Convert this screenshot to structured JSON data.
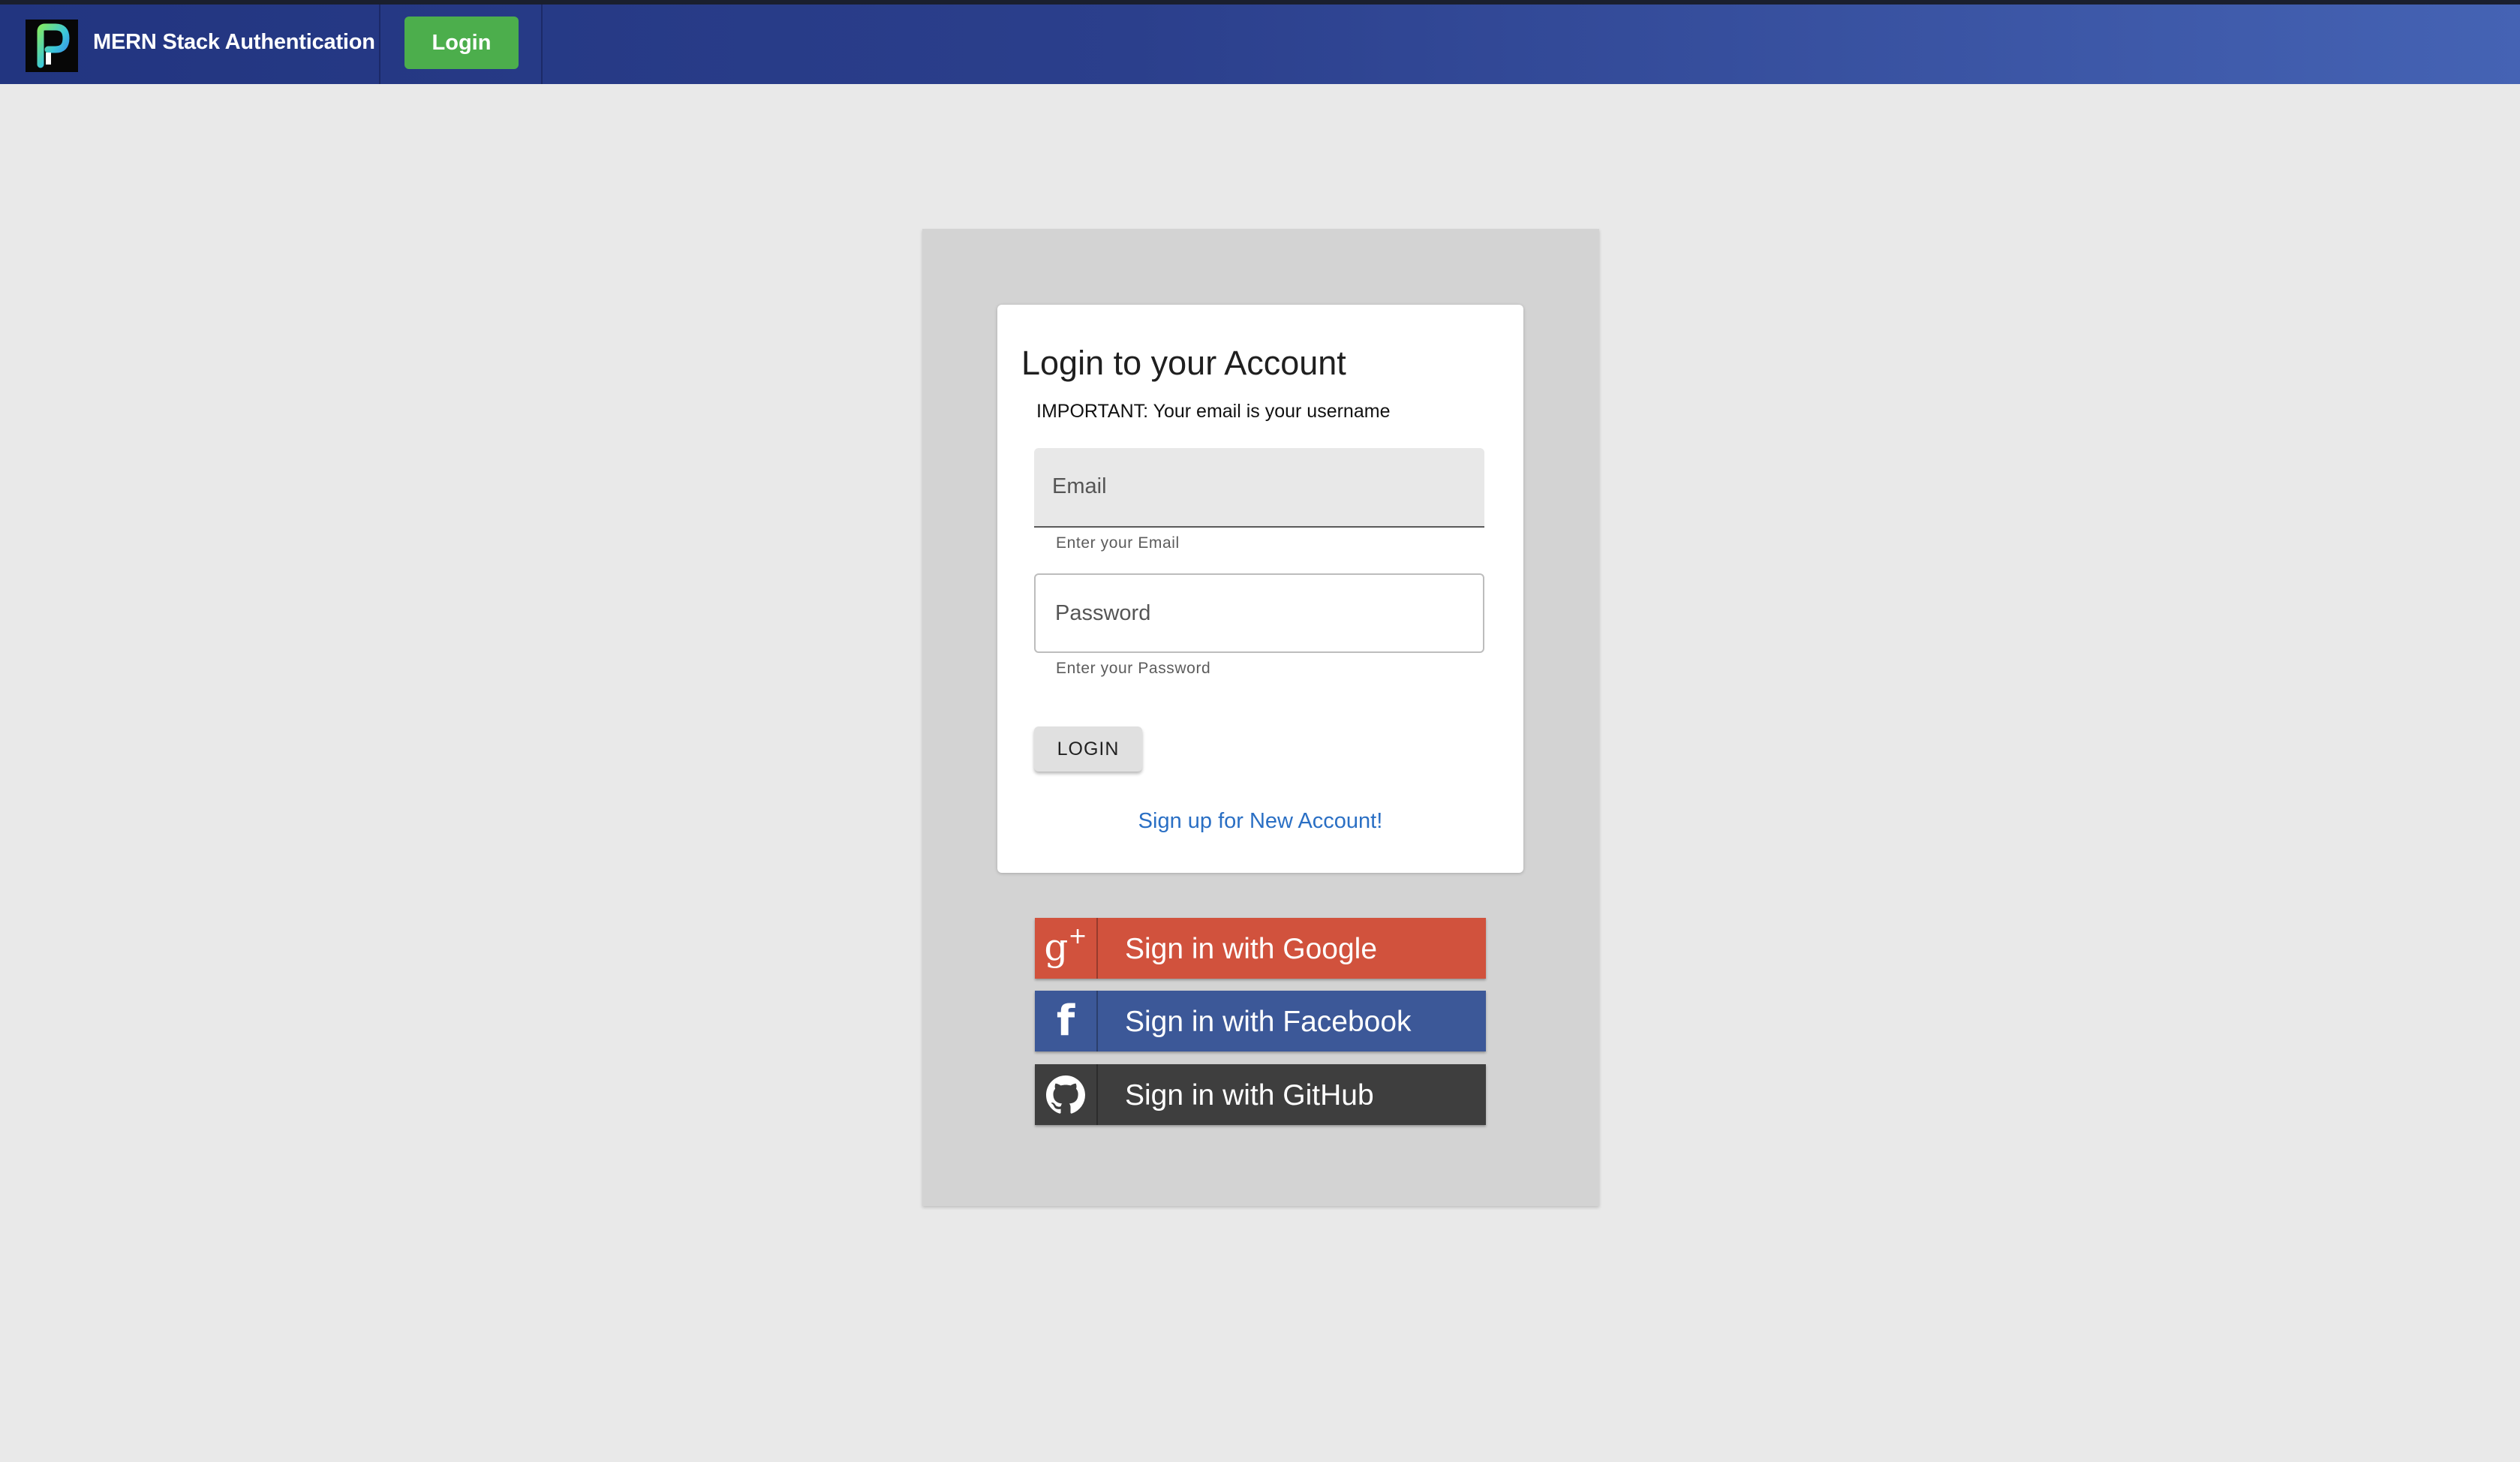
{
  "navbar": {
    "brand_title": "MERN Stack Authentication",
    "login_label": "Login",
    "logo_icon": "p-logo-icon",
    "colors": {
      "gradient_start": "#223580",
      "gradient_end": "#4563b4",
      "login_button": "#4cae4c"
    }
  },
  "login_card": {
    "title": "Login to your Account",
    "note": "IMPORTANT: Your email is your username",
    "email": {
      "placeholder": "Email",
      "value": "",
      "helper": "Enter your Email"
    },
    "password": {
      "placeholder": "Password",
      "value": "",
      "helper": "Enter your Password"
    },
    "login_button": "LOGIN",
    "signup_link": "Sign up for New Account!"
  },
  "social": {
    "google": {
      "label": "Sign in with Google",
      "icon": "google-plus-icon",
      "color": "#d1523d"
    },
    "facebook": {
      "label": "Sign in with Facebook",
      "icon": "facebook-icon",
      "color": "#3c5898"
    },
    "github": {
      "label": "Sign in with GitHub",
      "icon": "github-icon",
      "color": "#3e3e3e"
    }
  }
}
